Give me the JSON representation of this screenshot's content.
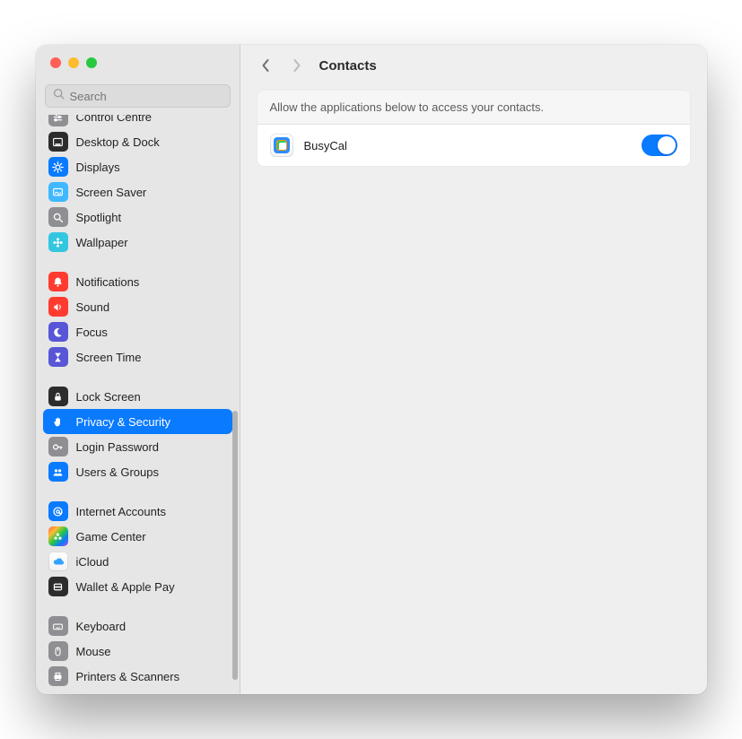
{
  "search": {
    "placeholder": "Search"
  },
  "sidebar": {
    "groups": [
      {
        "items": [
          {
            "id": "control-centre",
            "label": "Control Centre",
            "icon": "sliders",
            "bg": "bg-gray",
            "partial": true
          },
          {
            "id": "desktop-dock",
            "label": "Desktop & Dock",
            "icon": "dock",
            "bg": "bg-black"
          },
          {
            "id": "displays",
            "label": "Displays",
            "icon": "sun",
            "bg": "bg-blue"
          },
          {
            "id": "screen-saver",
            "label": "Screen Saver",
            "icon": "screensaver",
            "bg": "bg-lblue"
          },
          {
            "id": "spotlight",
            "label": "Spotlight",
            "icon": "search",
            "bg": "bg-gray"
          },
          {
            "id": "wallpaper",
            "label": "Wallpaper",
            "icon": "flower",
            "bg": "bg-cyan"
          }
        ]
      },
      {
        "items": [
          {
            "id": "notifications",
            "label": "Notifications",
            "icon": "bell",
            "bg": "bg-red"
          },
          {
            "id": "sound",
            "label": "Sound",
            "icon": "speaker",
            "bg": "bg-red"
          },
          {
            "id": "focus",
            "label": "Focus",
            "icon": "moon",
            "bg": "bg-purple"
          },
          {
            "id": "screen-time",
            "label": "Screen Time",
            "icon": "hourglass",
            "bg": "bg-purple"
          }
        ]
      },
      {
        "items": [
          {
            "id": "lock-screen",
            "label": "Lock Screen",
            "icon": "lock",
            "bg": "bg-black"
          },
          {
            "id": "privacy-security",
            "label": "Privacy & Security",
            "icon": "hand",
            "bg": "bg-blue",
            "selected": true
          },
          {
            "id": "login-password",
            "label": "Login Password",
            "icon": "key",
            "bg": "bg-gray"
          },
          {
            "id": "users-groups",
            "label": "Users & Groups",
            "icon": "people",
            "bg": "bg-blue"
          }
        ]
      },
      {
        "items": [
          {
            "id": "internet-accounts",
            "label": "Internet Accounts",
            "icon": "at",
            "bg": "bg-blue"
          },
          {
            "id": "game-center",
            "label": "Game Center",
            "icon": "game",
            "bg": "bg-rainbow"
          },
          {
            "id": "icloud",
            "label": "iCloud",
            "icon": "cloud",
            "bg": "bg-white"
          },
          {
            "id": "wallet-apple-pay",
            "label": "Wallet & Apple Pay",
            "icon": "wallet",
            "bg": "bg-black"
          }
        ]
      },
      {
        "items": [
          {
            "id": "keyboard",
            "label": "Keyboard",
            "icon": "keyboard",
            "bg": "bg-gray"
          },
          {
            "id": "mouse",
            "label": "Mouse",
            "icon": "mouse",
            "bg": "bg-gray"
          },
          {
            "id": "printers-scanners",
            "label": "Printers & Scanners",
            "icon": "printer",
            "bg": "bg-gray"
          }
        ]
      }
    ]
  },
  "page": {
    "title": "Contacts",
    "description": "Allow the applications below to access your contacts.",
    "apps": [
      {
        "name": "BusyCal",
        "enabled": true
      }
    ]
  }
}
